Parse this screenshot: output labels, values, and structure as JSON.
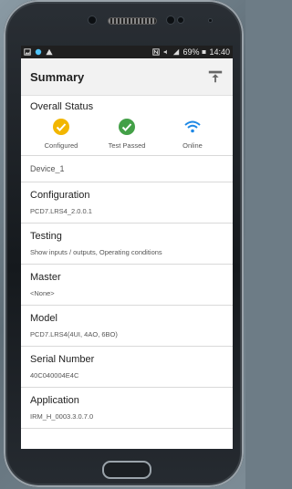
{
  "statusbar": {
    "battery": "69%",
    "time": "14:40"
  },
  "appbar": {
    "title": "Summary"
  },
  "overall": {
    "title": "Overall Status",
    "items": [
      {
        "label": "Configured",
        "color": "#f2b600"
      },
      {
        "label": "Test Passed",
        "color": "#43a047"
      },
      {
        "label": "Online",
        "color": "#1e88e5"
      }
    ]
  },
  "device": {
    "name": "Device_1"
  },
  "details": [
    {
      "title": "Configuration",
      "value": "PCD7.LRS4_2.0.0.1"
    },
    {
      "title": "Testing",
      "value": "Show inputs / outputs, Operating conditions"
    },
    {
      "title": "Master",
      "value": "<None>"
    },
    {
      "title": "Model",
      "value": "PCD7.LRS4(4UI, 4AO, 6BO)"
    },
    {
      "title": "Serial Number",
      "value": "40C040004E4C"
    },
    {
      "title": "Application",
      "value": "IRM_H_0003.3.0.7.0"
    }
  ]
}
